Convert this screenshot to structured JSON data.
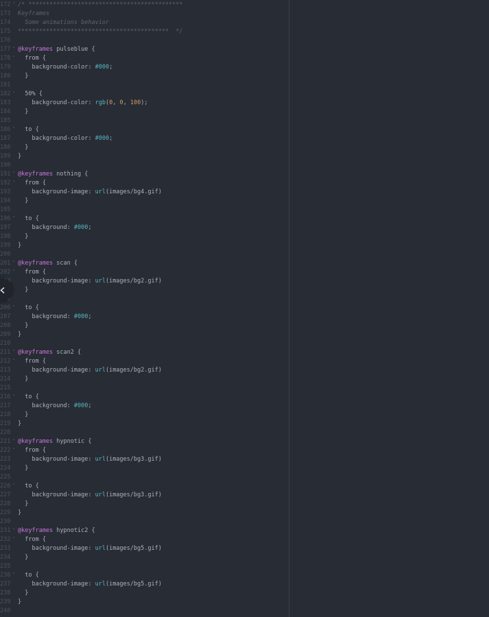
{
  "editor": {
    "colors": {
      "background": "#282c34",
      "line_number": "#4b5263",
      "comment": "#5c6370",
      "at_rule": "#c678dd",
      "text": "#abb2bf",
      "hex_and_function": "#56b6c2",
      "number": "#d19a66"
    },
    "lines": [
      {
        "n": "172",
        "fold": true,
        "tokens": [
          {
            "t": "comment",
            "v": "/* ********************************************"
          }
        ]
      },
      {
        "n": "173",
        "fold": false,
        "tokens": [
          {
            "t": "comment",
            "v": "Keyframes"
          }
        ]
      },
      {
        "n": "174",
        "fold": false,
        "tokens": [
          {
            "t": "comment",
            "v": "  Some animations behavior"
          }
        ]
      },
      {
        "n": "175",
        "fold": false,
        "tokens": [
          {
            "t": "comment",
            "v": "*******************************************  */"
          }
        ]
      },
      {
        "n": "176",
        "fold": false,
        "tokens": []
      },
      {
        "n": "177",
        "fold": true,
        "tokens": [
          {
            "t": "at",
            "v": "@keyframes"
          },
          {
            "t": "plain",
            "v": " pulseblue {"
          }
        ]
      },
      {
        "n": "178",
        "fold": true,
        "tokens": [
          {
            "t": "plain",
            "v": "  from {"
          }
        ]
      },
      {
        "n": "179",
        "fold": false,
        "tokens": [
          {
            "t": "prop",
            "v": "    background-color: "
          },
          {
            "t": "hex",
            "v": "#000"
          },
          {
            "t": "punct",
            "v": ";"
          }
        ]
      },
      {
        "n": "180",
        "fold": false,
        "tokens": [
          {
            "t": "plain",
            "v": "  }"
          }
        ]
      },
      {
        "n": "181",
        "fold": false,
        "tokens": []
      },
      {
        "n": "182",
        "fold": true,
        "tokens": [
          {
            "t": "plain",
            "v": "  50% {"
          }
        ]
      },
      {
        "n": "183",
        "fold": false,
        "tokens": [
          {
            "t": "prop",
            "v": "    background-color: "
          },
          {
            "t": "fn",
            "v": "rgb"
          },
          {
            "t": "punct",
            "v": "("
          },
          {
            "t": "num",
            "v": "0"
          },
          {
            "t": "punct",
            "v": ", "
          },
          {
            "t": "num",
            "v": "0"
          },
          {
            "t": "punct",
            "v": ", "
          },
          {
            "t": "num",
            "v": "100"
          },
          {
            "t": "punct",
            "v": ");"
          }
        ]
      },
      {
        "n": "184",
        "fold": false,
        "tokens": [
          {
            "t": "plain",
            "v": "  }"
          }
        ]
      },
      {
        "n": "185",
        "fold": false,
        "tokens": []
      },
      {
        "n": "186",
        "fold": true,
        "tokens": [
          {
            "t": "plain",
            "v": "  to {"
          }
        ]
      },
      {
        "n": "187",
        "fold": false,
        "tokens": [
          {
            "t": "prop",
            "v": "    background-color: "
          },
          {
            "t": "hex",
            "v": "#000"
          },
          {
            "t": "punct",
            "v": ";"
          }
        ]
      },
      {
        "n": "188",
        "fold": false,
        "tokens": [
          {
            "t": "plain",
            "v": "  }"
          }
        ]
      },
      {
        "n": "189",
        "fold": false,
        "tokens": [
          {
            "t": "plain",
            "v": "}"
          }
        ]
      },
      {
        "n": "190",
        "fold": false,
        "tokens": []
      },
      {
        "n": "191",
        "fold": true,
        "tokens": [
          {
            "t": "at",
            "v": "@keyframes"
          },
          {
            "t": "plain",
            "v": " nothing {"
          }
        ]
      },
      {
        "n": "192",
        "fold": true,
        "tokens": [
          {
            "t": "plain",
            "v": "  from {"
          }
        ]
      },
      {
        "n": "193",
        "fold": false,
        "tokens": [
          {
            "t": "prop",
            "v": "    background-image: "
          },
          {
            "t": "fn",
            "v": "url"
          },
          {
            "t": "str",
            "v": "(images/bg4.gif)"
          }
        ]
      },
      {
        "n": "194",
        "fold": false,
        "tokens": [
          {
            "t": "plain",
            "v": "  }"
          }
        ]
      },
      {
        "n": "195",
        "fold": false,
        "tokens": []
      },
      {
        "n": "196",
        "fold": true,
        "tokens": [
          {
            "t": "plain",
            "v": "  to {"
          }
        ]
      },
      {
        "n": "197",
        "fold": false,
        "tokens": [
          {
            "t": "prop",
            "v": "    background: "
          },
          {
            "t": "hex",
            "v": "#000"
          },
          {
            "t": "punct",
            "v": ";"
          }
        ]
      },
      {
        "n": "198",
        "fold": false,
        "tokens": [
          {
            "t": "plain",
            "v": "  }"
          }
        ]
      },
      {
        "n": "199",
        "fold": false,
        "tokens": [
          {
            "t": "plain",
            "v": "}"
          }
        ]
      },
      {
        "n": "200",
        "fold": false,
        "tokens": []
      },
      {
        "n": "201",
        "fold": true,
        "tokens": [
          {
            "t": "at",
            "v": "@keyframes"
          },
          {
            "t": "plain",
            "v": " scan {"
          }
        ]
      },
      {
        "n": "202",
        "fold": true,
        "tokens": [
          {
            "t": "plain",
            "v": "  from {"
          }
        ]
      },
      {
        "n": "203",
        "fold": false,
        "tokens": [
          {
            "t": "prop",
            "v": "    background-image: "
          },
          {
            "t": "fn",
            "v": "url"
          },
          {
            "t": "str",
            "v": "(images/bg2.gif)"
          }
        ]
      },
      {
        "n": "204",
        "fold": false,
        "tokens": [
          {
            "t": "plain",
            "v": "  }"
          }
        ]
      },
      {
        "n": "205",
        "fold": false,
        "tokens": []
      },
      {
        "n": "206",
        "fold": true,
        "tokens": [
          {
            "t": "plain",
            "v": "  to {"
          }
        ]
      },
      {
        "n": "207",
        "fold": false,
        "tokens": [
          {
            "t": "prop",
            "v": "    background: "
          },
          {
            "t": "hex",
            "v": "#000"
          },
          {
            "t": "punct",
            "v": ";"
          }
        ]
      },
      {
        "n": "208",
        "fold": false,
        "tokens": [
          {
            "t": "plain",
            "v": "  }"
          }
        ]
      },
      {
        "n": "209",
        "fold": false,
        "tokens": [
          {
            "t": "plain",
            "v": "}"
          }
        ]
      },
      {
        "n": "210",
        "fold": false,
        "tokens": []
      },
      {
        "n": "211",
        "fold": true,
        "tokens": [
          {
            "t": "at",
            "v": "@keyframes"
          },
          {
            "t": "plain",
            "v": " scan2 {"
          }
        ]
      },
      {
        "n": "212",
        "fold": true,
        "tokens": [
          {
            "t": "plain",
            "v": "  from {"
          }
        ]
      },
      {
        "n": "213",
        "fold": false,
        "tokens": [
          {
            "t": "prop",
            "v": "    background-image: "
          },
          {
            "t": "fn",
            "v": "url"
          },
          {
            "t": "str",
            "v": "(images/bg2.gif)"
          }
        ]
      },
      {
        "n": "214",
        "fold": false,
        "tokens": [
          {
            "t": "plain",
            "v": "  }"
          }
        ]
      },
      {
        "n": "215",
        "fold": false,
        "tokens": []
      },
      {
        "n": "216",
        "fold": true,
        "tokens": [
          {
            "t": "plain",
            "v": "  to {"
          }
        ]
      },
      {
        "n": "217",
        "fold": false,
        "tokens": [
          {
            "t": "prop",
            "v": "    background: "
          },
          {
            "t": "hex",
            "v": "#000"
          },
          {
            "t": "punct",
            "v": ";"
          }
        ]
      },
      {
        "n": "218",
        "fold": false,
        "tokens": [
          {
            "t": "plain",
            "v": "  }"
          }
        ]
      },
      {
        "n": "219",
        "fold": false,
        "tokens": [
          {
            "t": "plain",
            "v": "}"
          }
        ]
      },
      {
        "n": "220",
        "fold": false,
        "tokens": []
      },
      {
        "n": "221",
        "fold": true,
        "tokens": [
          {
            "t": "at",
            "v": "@keyframes"
          },
          {
            "t": "plain",
            "v": " hypnotic {"
          }
        ]
      },
      {
        "n": "222",
        "fold": true,
        "tokens": [
          {
            "t": "plain",
            "v": "  from {"
          }
        ]
      },
      {
        "n": "223",
        "fold": false,
        "tokens": [
          {
            "t": "prop",
            "v": "    background-image: "
          },
          {
            "t": "fn",
            "v": "url"
          },
          {
            "t": "str",
            "v": "(images/bg3.gif)"
          }
        ]
      },
      {
        "n": "224",
        "fold": false,
        "tokens": [
          {
            "t": "plain",
            "v": "  }"
          }
        ]
      },
      {
        "n": "225",
        "fold": false,
        "tokens": []
      },
      {
        "n": "226",
        "fold": true,
        "tokens": [
          {
            "t": "plain",
            "v": "  to {"
          }
        ]
      },
      {
        "n": "227",
        "fold": false,
        "tokens": [
          {
            "t": "prop",
            "v": "    background-image: "
          },
          {
            "t": "fn",
            "v": "url"
          },
          {
            "t": "str",
            "v": "(images/bg3.gif)"
          }
        ]
      },
      {
        "n": "228",
        "fold": false,
        "tokens": [
          {
            "t": "plain",
            "v": "  }"
          }
        ]
      },
      {
        "n": "229",
        "fold": false,
        "tokens": [
          {
            "t": "plain",
            "v": "}"
          }
        ]
      },
      {
        "n": "230",
        "fold": false,
        "tokens": []
      },
      {
        "n": "231",
        "fold": true,
        "tokens": [
          {
            "t": "at",
            "v": "@keyframes"
          },
          {
            "t": "plain",
            "v": " hypnotic2 {"
          }
        ]
      },
      {
        "n": "232",
        "fold": true,
        "tokens": [
          {
            "t": "plain",
            "v": "  from {"
          }
        ]
      },
      {
        "n": "233",
        "fold": false,
        "tokens": [
          {
            "t": "prop",
            "v": "    background-image: "
          },
          {
            "t": "fn",
            "v": "url"
          },
          {
            "t": "str",
            "v": "(images/bg5.gif)"
          }
        ]
      },
      {
        "n": "234",
        "fold": false,
        "tokens": [
          {
            "t": "plain",
            "v": "  }"
          }
        ]
      },
      {
        "n": "235",
        "fold": false,
        "tokens": []
      },
      {
        "n": "236",
        "fold": true,
        "tokens": [
          {
            "t": "plain",
            "v": "  to {"
          }
        ]
      },
      {
        "n": "237",
        "fold": false,
        "tokens": [
          {
            "t": "prop",
            "v": "    background-image: "
          },
          {
            "t": "fn",
            "v": "url"
          },
          {
            "t": "str",
            "v": "(images/bg5.gif)"
          }
        ]
      },
      {
        "n": "238",
        "fold": false,
        "tokens": [
          {
            "t": "plain",
            "v": "  }"
          }
        ]
      },
      {
        "n": "239",
        "fold": false,
        "tokens": [
          {
            "t": "plain",
            "v": "}"
          }
        ]
      },
      {
        "n": "240",
        "fold": false,
        "tokens": []
      }
    ]
  },
  "panel_toggle": {
    "icon": "chevron-left-icon"
  }
}
